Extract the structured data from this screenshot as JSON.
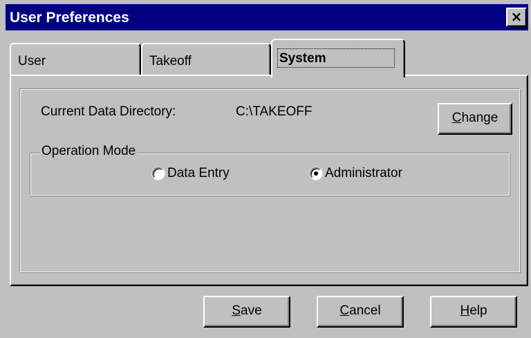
{
  "window": {
    "title": "User Preferences",
    "close_glyph": "×",
    "close_icon": "close-icon"
  },
  "tabs": [
    {
      "label": "User",
      "selected": false
    },
    {
      "label": "Takeoff",
      "selected": false
    },
    {
      "label": "System",
      "selected": true
    }
  ],
  "system": {
    "data_directory_label": "Current Data Directory:",
    "data_directory_value": "C:\\TAKEOFF",
    "change_button": {
      "accel": "C",
      "rest": "hange"
    },
    "operation_mode": {
      "legend": "Operation Mode",
      "options": [
        {
          "label": "Data Entry",
          "selected": false
        },
        {
          "label": "Administrator",
          "selected": true
        }
      ]
    }
  },
  "buttons": {
    "save": {
      "accel": "S",
      "rest": "ave"
    },
    "cancel": {
      "accel": "C",
      "rest": "ancel"
    },
    "help": {
      "accel": "H",
      "rest": "elp"
    }
  },
  "colors": {
    "titlebar": "#000080",
    "face": "#c0c0c0"
  }
}
